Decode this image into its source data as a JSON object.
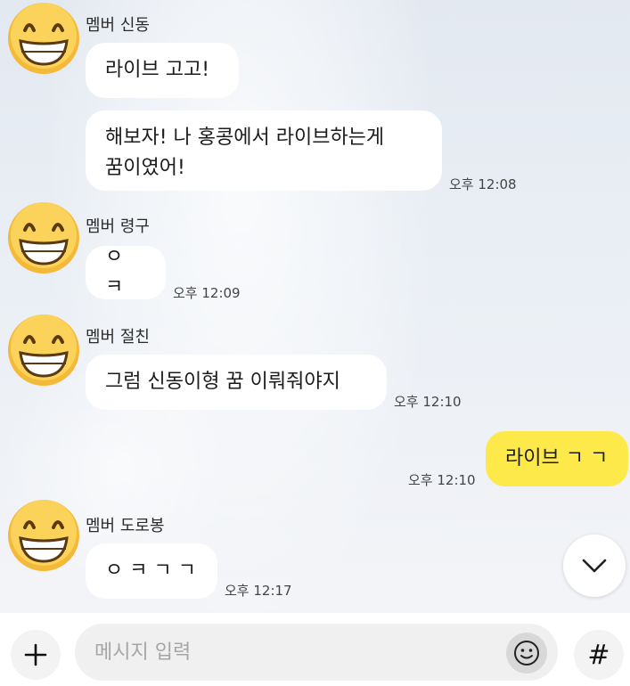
{
  "messages": [
    {
      "sender": "멤버 신동",
      "bubbles": [
        "라이브 고고!",
        "해보자! 나 홍콩에서 라이브하는게 꿈이였어!"
      ],
      "time": "오후 12:08"
    },
    {
      "sender": "멤버 령구",
      "bubbles": [
        "ㅇ ㅋ"
      ],
      "time": "오후 12:09"
    },
    {
      "sender": "멤버 절친",
      "bubbles": [
        "그럼 신동이형 꿈 이뤄줘야지"
      ],
      "time": "오후 12:10"
    },
    {
      "sender": "me",
      "bubbles": [
        "라이브 ㄱ ㄱ"
      ],
      "time": "오후 12:10"
    },
    {
      "sender": "멤버 도로봉",
      "bubbles": [
        "ㅇ ㅋ ㄱ ㄱ"
      ],
      "time": "오후 12:17"
    }
  ],
  "bubble2_line1": "해보자! 나 홍콩에서 라이브하는게",
  "bubble2_line2": "꿈이였어!",
  "composer": {
    "placeholder": "메시지 입력",
    "plus_icon": "plus-icon",
    "emoji_icon": "smiley-icon",
    "hash_label": "#"
  },
  "scroll_icon": "chevron-down-icon",
  "colors": {
    "my_bubble": "#fde94a",
    "other_bubble": "#ffffff",
    "avatar_face": "#f7c64a"
  }
}
